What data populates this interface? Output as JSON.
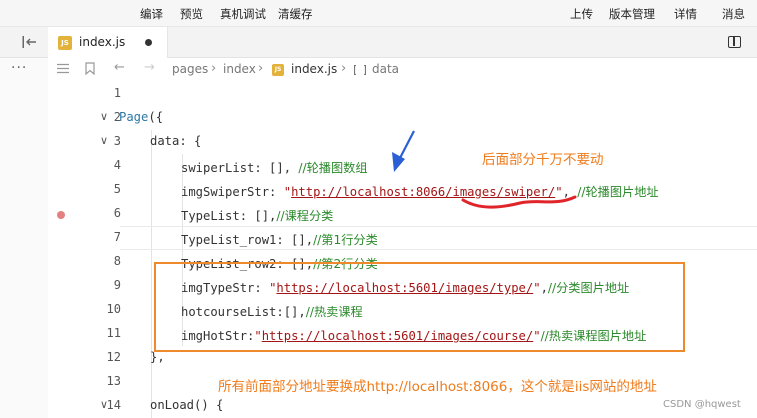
{
  "toolbar": {
    "left_items": [
      "编译",
      "预览",
      "真机调试",
      "清缓存"
    ],
    "right_items": [
      "上传",
      "版本管理",
      "详情",
      "消息"
    ]
  },
  "tab": {
    "badge": "JS",
    "filename": "index.js",
    "unsaved": true
  },
  "rail": {
    "more": "···"
  },
  "breadcrumb": {
    "items": [
      "pages",
      "index",
      "index.js",
      "data"
    ]
  },
  "code_lines": [
    {
      "n": "1",
      "parts": []
    },
    {
      "n": "2",
      "fold": "∨",
      "parts": [
        [
          "k",
          "Page"
        ],
        [
          "p",
          "({"
        ]
      ]
    },
    {
      "n": "3",
      "fold": "∨",
      "parts": [
        [
          "p",
          "data: "
        ],
        [
          "p",
          "{"
        ]
      ]
    },
    {
      "n": "4",
      "parts": [
        [
          "p",
          "swiperList: [], "
        ],
        [
          "c",
          "//轮播图数组"
        ]
      ]
    },
    {
      "n": "5",
      "parts": [
        [
          "p",
          "imgSwiperStr: "
        ],
        [
          "s",
          "\""
        ],
        [
          "u",
          "http://localhost:8066/images/swiper/"
        ],
        [
          "s",
          "\""
        ],
        [
          "p",
          ", "
        ],
        [
          "c",
          "//轮播图片地址"
        ]
      ]
    },
    {
      "n": "6",
      "breakpoint": true,
      "parts": [
        [
          "p",
          "TypeList: [],"
        ],
        [
          "c",
          "//课程分类"
        ]
      ]
    },
    {
      "n": "7",
      "parts": [
        [
          "p",
          "TypeList_row1: [],"
        ],
        [
          "c",
          "//第1行分类"
        ]
      ]
    },
    {
      "n": "8",
      "parts": [
        [
          "p",
          "TypeList_row2: [],"
        ],
        [
          "c",
          "//第2行分类"
        ]
      ]
    },
    {
      "n": "9",
      "parts": [
        [
          "p",
          "imgTypeStr: "
        ],
        [
          "s",
          "\""
        ],
        [
          "u",
          "https://localhost:5601/images/type/"
        ],
        [
          "s",
          "\""
        ],
        [
          "p",
          ","
        ],
        [
          "c",
          "//分类图片地址"
        ]
      ]
    },
    {
      "n": "10",
      "parts": [
        [
          "p",
          "hotcourseList:[],"
        ],
        [
          "c",
          "//热卖课程"
        ]
      ]
    },
    {
      "n": "11",
      "parts": [
        [
          "p",
          "imgHotStr:"
        ],
        [
          "s",
          "\""
        ],
        [
          "u",
          "https://localhost:5601/images/course/"
        ],
        [
          "s",
          "\""
        ],
        [
          "c",
          "//热卖课程图片地址"
        ]
      ]
    },
    {
      "n": "12",
      "parts": [
        [
          "p",
          "},"
        ]
      ]
    },
    {
      "n": "13",
      "parts": []
    },
    {
      "n": "14",
      "fold": "∨",
      "parts": [
        [
          "p",
          "onLoad() {"
        ]
      ]
    }
  ],
  "annotations": {
    "top_note": "后面部分千万不要动",
    "bottom_note": "所有前面部分地址要换成http://localhost:8066，这个就是iis网站的地址"
  },
  "watermark": "CSDN @hqwest",
  "colors": {
    "annotation": "#f07b1a",
    "box": "#ef8a2c",
    "arrow": "#2b5fd6",
    "squiggle": "#e0242a"
  }
}
